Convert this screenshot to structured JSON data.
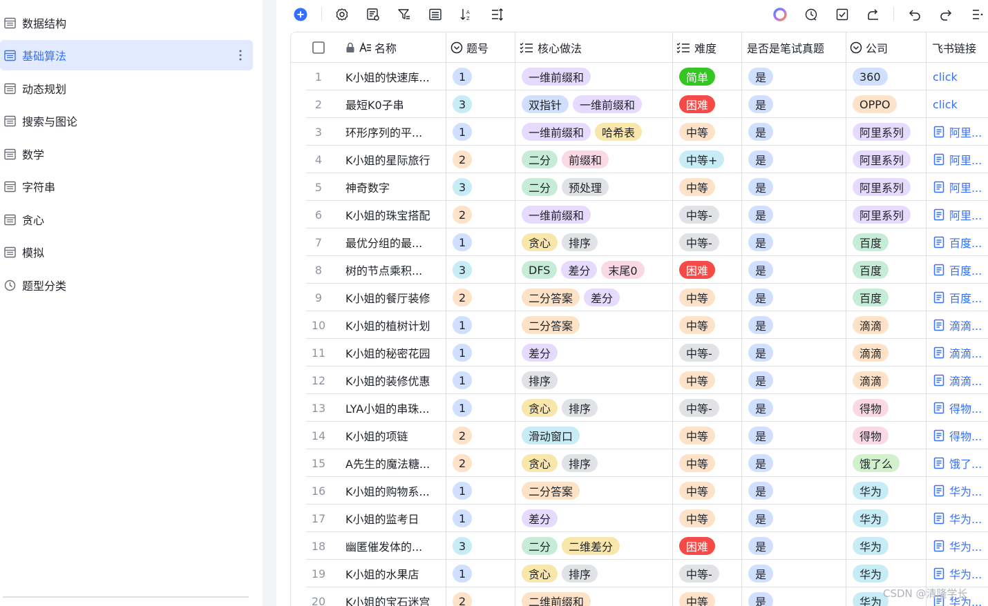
{
  "sidebar": {
    "items": [
      {
        "label": "数据结构",
        "icon": "table-icon",
        "active": false
      },
      {
        "label": "基础算法",
        "icon": "table-icon",
        "active": true
      },
      {
        "label": "动态规划",
        "icon": "table-icon",
        "active": false
      },
      {
        "label": "搜索与图论",
        "icon": "table-icon",
        "active": false
      },
      {
        "label": "数学",
        "icon": "table-icon",
        "active": false
      },
      {
        "label": "字符串",
        "icon": "table-icon",
        "active": false
      },
      {
        "label": "贪心",
        "icon": "table-icon",
        "active": false
      },
      {
        "label": "模拟",
        "icon": "table-icon",
        "active": false
      },
      {
        "label": "题型分类",
        "icon": "dashboard-icon",
        "active": false
      }
    ]
  },
  "toolbar": {
    "icons": [
      "add-icon",
      "settings-icon",
      "form-icon",
      "filter-icon",
      "group-icon",
      "sort-icon",
      "row-height-icon",
      "ai-icon",
      "history-icon",
      "checklist-icon",
      "share-icon",
      "undo-icon",
      "redo-icon",
      "more-icon"
    ]
  },
  "columns": {
    "name": "名称",
    "number": "题号",
    "method": "核心做法",
    "difficulty": "难度",
    "exam": "是否是笔试真题",
    "company": "公司",
    "link": "飞书链接"
  },
  "colors": {
    "accent": "#3370ff",
    "active_bg": "#e1eaff",
    "border": "#dee0e3"
  },
  "rows": [
    {
      "n": "1",
      "name": "K小姐的快速库...",
      "num": "1",
      "methods": [
        "一维前缀和"
      ],
      "diff": "简单",
      "exam": "是",
      "company": "360",
      "link": "click",
      "link_doc": false
    },
    {
      "n": "2",
      "name": "最短K0子串",
      "num": "3",
      "methods": [
        "双指针",
        "一维前缀和"
      ],
      "diff": "困难",
      "exam": "是",
      "company": "OPPO",
      "link": "click",
      "link_doc": false
    },
    {
      "n": "3",
      "name": "环形序列的平...",
      "num": "1",
      "methods": [
        "一维前缀和",
        "哈希表"
      ],
      "diff": "中等",
      "exam": "是",
      "company": "阿里系列",
      "link": "阿里...",
      "link_doc": true
    },
    {
      "n": "4",
      "name": "K小姐的星际旅行",
      "num": "2",
      "methods": [
        "二分",
        "前缀和"
      ],
      "diff": "中等+",
      "exam": "是",
      "company": "阿里系列",
      "link": "阿里...",
      "link_doc": true
    },
    {
      "n": "5",
      "name": "神奇数字",
      "num": "3",
      "methods": [
        "二分",
        "预处理"
      ],
      "diff": "中等",
      "exam": "是",
      "company": "阿里系列",
      "link": "阿里...",
      "link_doc": true
    },
    {
      "n": "6",
      "name": "K小姐的珠宝搭配",
      "num": "2",
      "methods": [
        "一维前缀和"
      ],
      "diff": "中等-",
      "exam": "是",
      "company": "阿里系列",
      "link": "阿里...",
      "link_doc": true
    },
    {
      "n": "7",
      "name": "最优分组的最...",
      "num": "1",
      "methods": [
        "贪心",
        "排序"
      ],
      "diff": "中等-",
      "exam": "是",
      "company": "百度",
      "link": "百度...",
      "link_doc": true
    },
    {
      "n": "8",
      "name": "树的节点乘积...",
      "num": "3",
      "methods": [
        "DFS",
        "差分",
        "末尾0"
      ],
      "diff": "困难",
      "exam": "是",
      "company": "百度",
      "link": "百度...",
      "link_doc": true
    },
    {
      "n": "9",
      "name": "K小姐的餐厅装修",
      "num": "2",
      "methods": [
        "二分答案",
        "差分"
      ],
      "diff": "中等",
      "exam": "是",
      "company": "百度",
      "link": "百度...",
      "link_doc": true
    },
    {
      "n": "10",
      "name": "K小姐的植树计划",
      "num": "1",
      "methods": [
        "二分答案"
      ],
      "diff": "中等",
      "exam": "是",
      "company": "滴滴",
      "link": "滴滴...",
      "link_doc": true
    },
    {
      "n": "11",
      "name": "K小姐的秘密花园",
      "num": "1",
      "methods": [
        "差分"
      ],
      "diff": "中等-",
      "exam": "是",
      "company": "滴滴",
      "link": "滴滴...",
      "link_doc": true
    },
    {
      "n": "12",
      "name": "K小姐的装修优惠",
      "num": "1",
      "methods": [
        "排序"
      ],
      "diff": "中等",
      "exam": "是",
      "company": "滴滴",
      "link": "滴滴...",
      "link_doc": true
    },
    {
      "n": "13",
      "name": "LYA小姐的串珠...",
      "num": "1",
      "methods": [
        "贪心",
        "排序"
      ],
      "diff": "中等-",
      "exam": "是",
      "company": "得物",
      "link": "得物...",
      "link_doc": true
    },
    {
      "n": "14",
      "name": "K小姐的项链",
      "num": "2",
      "methods": [
        "滑动窗口"
      ],
      "diff": "中等",
      "exam": "是",
      "company": "得物",
      "link": "得物...",
      "link_doc": true
    },
    {
      "n": "15",
      "name": "A先生的魔法糖...",
      "num": "2",
      "methods": [
        "贪心",
        "排序"
      ],
      "diff": "中等",
      "exam": "是",
      "company": "饿了么",
      "link": "饿了...",
      "link_doc": true
    },
    {
      "n": "16",
      "name": "K小姐的购物系...",
      "num": "1",
      "methods": [
        "二分答案"
      ],
      "diff": "中等",
      "exam": "是",
      "company": "华为",
      "link": "华为...",
      "link_doc": true
    },
    {
      "n": "17",
      "name": "K小姐的监考日",
      "num": "1",
      "methods": [
        "差分"
      ],
      "diff": "中等",
      "exam": "是",
      "company": "华为",
      "link": "华为...",
      "link_doc": true
    },
    {
      "n": "18",
      "name": "幽匿催发体的...",
      "num": "3",
      "methods": [
        "二分",
        "二维差分"
      ],
      "diff": "困难",
      "exam": "是",
      "company": "华为",
      "link": "华为...",
      "link_doc": true
    },
    {
      "n": "19",
      "name": "K小姐的水果店",
      "num": "1",
      "methods": [
        "贪心",
        "排序"
      ],
      "diff": "中等-",
      "exam": "是",
      "company": "华为",
      "link": "华为...",
      "link_doc": true
    },
    {
      "n": "20",
      "name": "K小姐的宝石迷宫",
      "num": "2",
      "methods": [
        "二维前缀和"
      ],
      "diff": "中等",
      "exam": "是",
      "company": "华为",
      "link": "华为...",
      "link_doc": true
    }
  ],
  "watermark": "CSDN @清隆学长"
}
